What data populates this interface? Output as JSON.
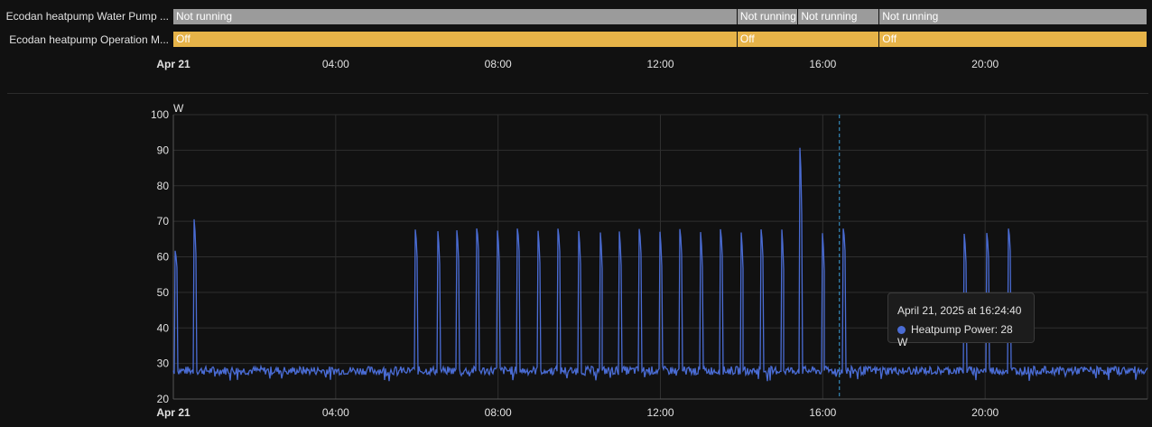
{
  "timeline": {
    "rows": [
      {
        "label": "Ecodan heatpump Water Pump ...",
        "color": "#9b9b9b",
        "segments": [
          {
            "text": "Not running",
            "start": 0,
            "end": 13.9
          },
          {
            "text": "Not running",
            "start": 13.9,
            "end": 15.4
          },
          {
            "text": "Not running",
            "start": 15.4,
            "end": 17.4
          },
          {
            "text": "Not running",
            "start": 17.4,
            "end": 24
          }
        ]
      },
      {
        "label": "Ecodan heatpump Operation M...",
        "color": "#e6b348",
        "segments": [
          {
            "text": "Off",
            "start": 0,
            "end": 13.9
          },
          {
            "text": "Off",
            "start": 13.9,
            "end": 17.4
          },
          {
            "text": "Off",
            "start": 17.4,
            "end": 24
          }
        ]
      }
    ],
    "ticks": [
      "Apr 21",
      "04:00",
      "08:00",
      "12:00",
      "16:00",
      "20:00"
    ]
  },
  "chart_data": {
    "type": "line",
    "unit": "W",
    "xlabel": "",
    "ylabel": "W",
    "x_range_hours": [
      0,
      24
    ],
    "ylim": [
      20,
      100
    ],
    "y_ticks": [
      20,
      30,
      40,
      50,
      60,
      70,
      80,
      90,
      100
    ],
    "x_ticks": [
      {
        "label": "Apr 21",
        "hour": 0
      },
      {
        "label": "04:00",
        "hour": 4
      },
      {
        "label": "08:00",
        "hour": 8
      },
      {
        "label": "12:00",
        "hour": 12
      },
      {
        "label": "16:00",
        "hour": 16
      },
      {
        "label": "20:00",
        "hour": 20
      }
    ],
    "grid": true,
    "color": "#4a6cd4",
    "series": [
      {
        "name": "Heatpump Power",
        "baseline": 28,
        "spikes": [
          {
            "hour": 0.03,
            "peak": 62
          },
          {
            "hour": 0.5,
            "peak": 71
          },
          {
            "hour": 5.95,
            "peak": 68
          },
          {
            "hour": 6.5,
            "peak": 68
          },
          {
            "hour": 6.97,
            "peak": 68
          },
          {
            "hour": 7.47,
            "peak": 68
          },
          {
            "hour": 7.97,
            "peak": 68
          },
          {
            "hour": 8.47,
            "peak": 68
          },
          {
            "hour": 8.97,
            "peak": 68
          },
          {
            "hour": 9.47,
            "peak": 68
          },
          {
            "hour": 9.97,
            "peak": 68
          },
          {
            "hour": 10.5,
            "peak": 68
          },
          {
            "hour": 10.97,
            "peak": 68
          },
          {
            "hour": 11.47,
            "peak": 68
          },
          {
            "hour": 11.97,
            "peak": 68
          },
          {
            "hour": 12.47,
            "peak": 68
          },
          {
            "hour": 12.97,
            "peak": 68
          },
          {
            "hour": 13.47,
            "peak": 68
          },
          {
            "hour": 13.97,
            "peak": 68
          },
          {
            "hour": 14.47,
            "peak": 68
          },
          {
            "hour": 14.97,
            "peak": 69
          },
          {
            "hour": 15.43,
            "peak": 91
          },
          {
            "hour": 15.97,
            "peak": 68
          },
          {
            "hour": 16.5,
            "peak": 68
          },
          {
            "hour": 19.47,
            "peak": 67
          },
          {
            "hour": 20.03,
            "peak": 67
          },
          {
            "hour": 20.57,
            "peak": 68
          }
        ]
      }
    ],
    "cursor_hour": 16.41,
    "tooltip": {
      "title": "April 21, 2025 at 16:24:40",
      "series_name": "Heatpump Power",
      "value_text": "Heatpump Power: 28 W"
    }
  }
}
